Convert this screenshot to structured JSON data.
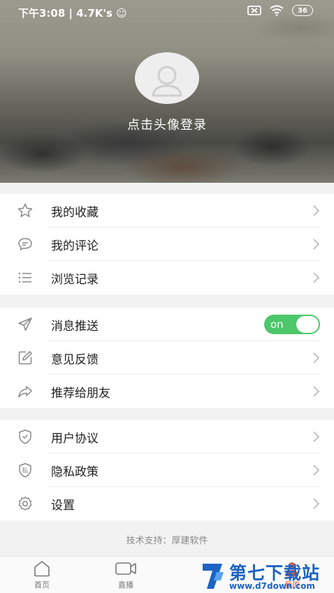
{
  "status_bar": {
    "time": "下午3:08 | 4.7K's ☺",
    "battery": "36"
  },
  "profile": {
    "login_prompt": "点击头像登录"
  },
  "group1": [
    {
      "label": "我的收藏",
      "icon": "star-icon"
    },
    {
      "label": "我的评论",
      "icon": "comment-icon"
    },
    {
      "label": "浏览记录",
      "icon": "list-icon"
    }
  ],
  "group2": [
    {
      "label": "消息推送",
      "icon": "send-icon",
      "toggle": "on"
    },
    {
      "label": "意见反馈",
      "icon": "edit-icon"
    },
    {
      "label": "推荐给朋友",
      "icon": "share-icon"
    }
  ],
  "group3": [
    {
      "label": "用户协议",
      "icon": "shield-icon"
    },
    {
      "label": "隐私政策",
      "icon": "privacy-shield-icon",
      "badge": "私"
    },
    {
      "label": "设置",
      "icon": "gear-icon"
    }
  ],
  "footer": {
    "support": "技术支持：厚建软件"
  },
  "tabs": [
    {
      "label": "首页",
      "icon": "home-icon"
    },
    {
      "label": "直播",
      "icon": "video-icon"
    },
    {
      "label": "我的",
      "icon": "user-icon"
    }
  ],
  "watermark": {
    "title": "第七下载站",
    "url": "www.d7down.com"
  },
  "colors": {
    "toggle_on": "#4cc76a",
    "watermark_blue": "#1c64c4",
    "background": "#f2f2f2"
  }
}
